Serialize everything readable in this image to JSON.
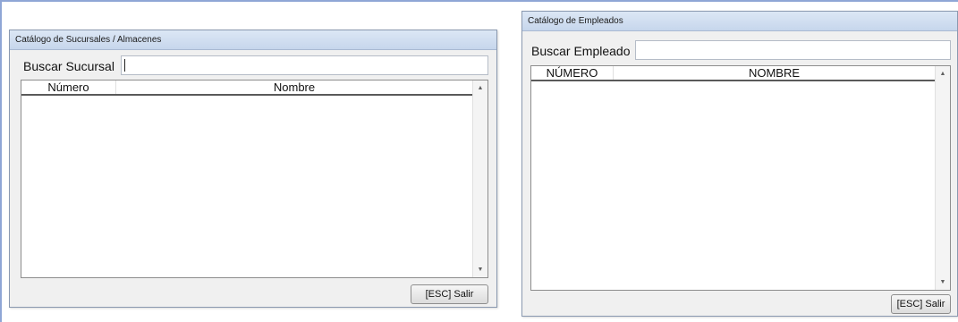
{
  "sucursales": {
    "title": "Catálogo de Sucursales / Almacenes",
    "search_label": "Buscar Sucursal",
    "search_value": "",
    "columns": [
      "Número",
      "Nombre"
    ],
    "exit_button": "[ESC] Salir"
  },
  "empleados": {
    "title": "Catálogo de Empleados",
    "search_label": "Buscar Empleado",
    "search_value": "",
    "columns": [
      "NÚMERO",
      "NOMBRE"
    ],
    "exit_button": "[ESC] Salir"
  },
  "icons": {
    "scroll_up": "up-arrow-icon",
    "scroll_down": "down-arrow-icon"
  },
  "colors": {
    "titlebar": "#c6d6ec",
    "window_bg": "#f0f0f0",
    "frame_accent": "#8fa6d6"
  }
}
